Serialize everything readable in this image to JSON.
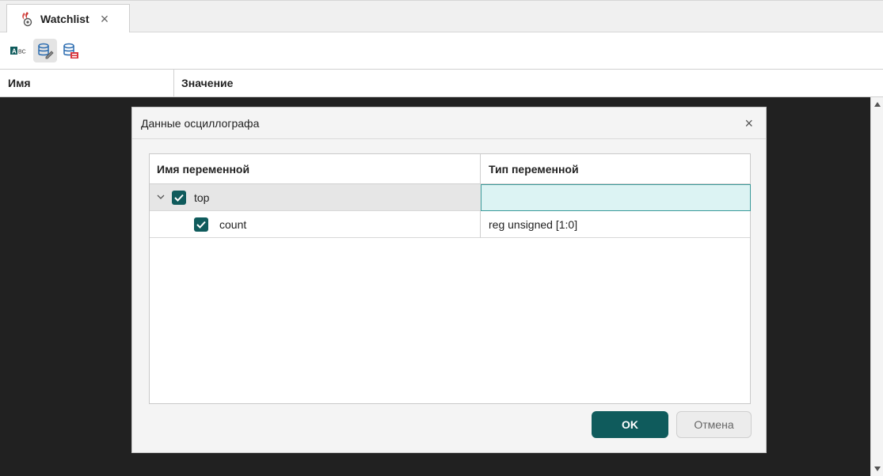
{
  "tab": {
    "title": "Watchlist",
    "close_glyph": "×",
    "icon": "watchlist-flame-icon"
  },
  "toolbar": {
    "buttons": [
      {
        "icon": "abc-text-icon",
        "label": "ABC"
      },
      {
        "icon": "database-edit-icon",
        "active": true
      },
      {
        "icon": "database-pdf-icon"
      }
    ]
  },
  "columns": {
    "name": "Имя",
    "value": "Значение"
  },
  "dialog": {
    "title": "Данные осциллографа",
    "close_glyph": "×",
    "table": {
      "headers": {
        "name": "Имя переменной",
        "type": "Тип переменной"
      },
      "rows": [
        {
          "name": "top",
          "type": "",
          "checked": true,
          "expanded": true,
          "level": 0
        },
        {
          "name": "count",
          "type": "reg unsigned [1:0]",
          "checked": true,
          "level": 1
        }
      ]
    },
    "ok_label": "OK",
    "cancel_label": "Отмена"
  },
  "colors": {
    "accent": "#0f5b5c",
    "selection_fill": "#dcf3f3",
    "selection_border": "#3b9a9a",
    "overlay": "#212121"
  }
}
